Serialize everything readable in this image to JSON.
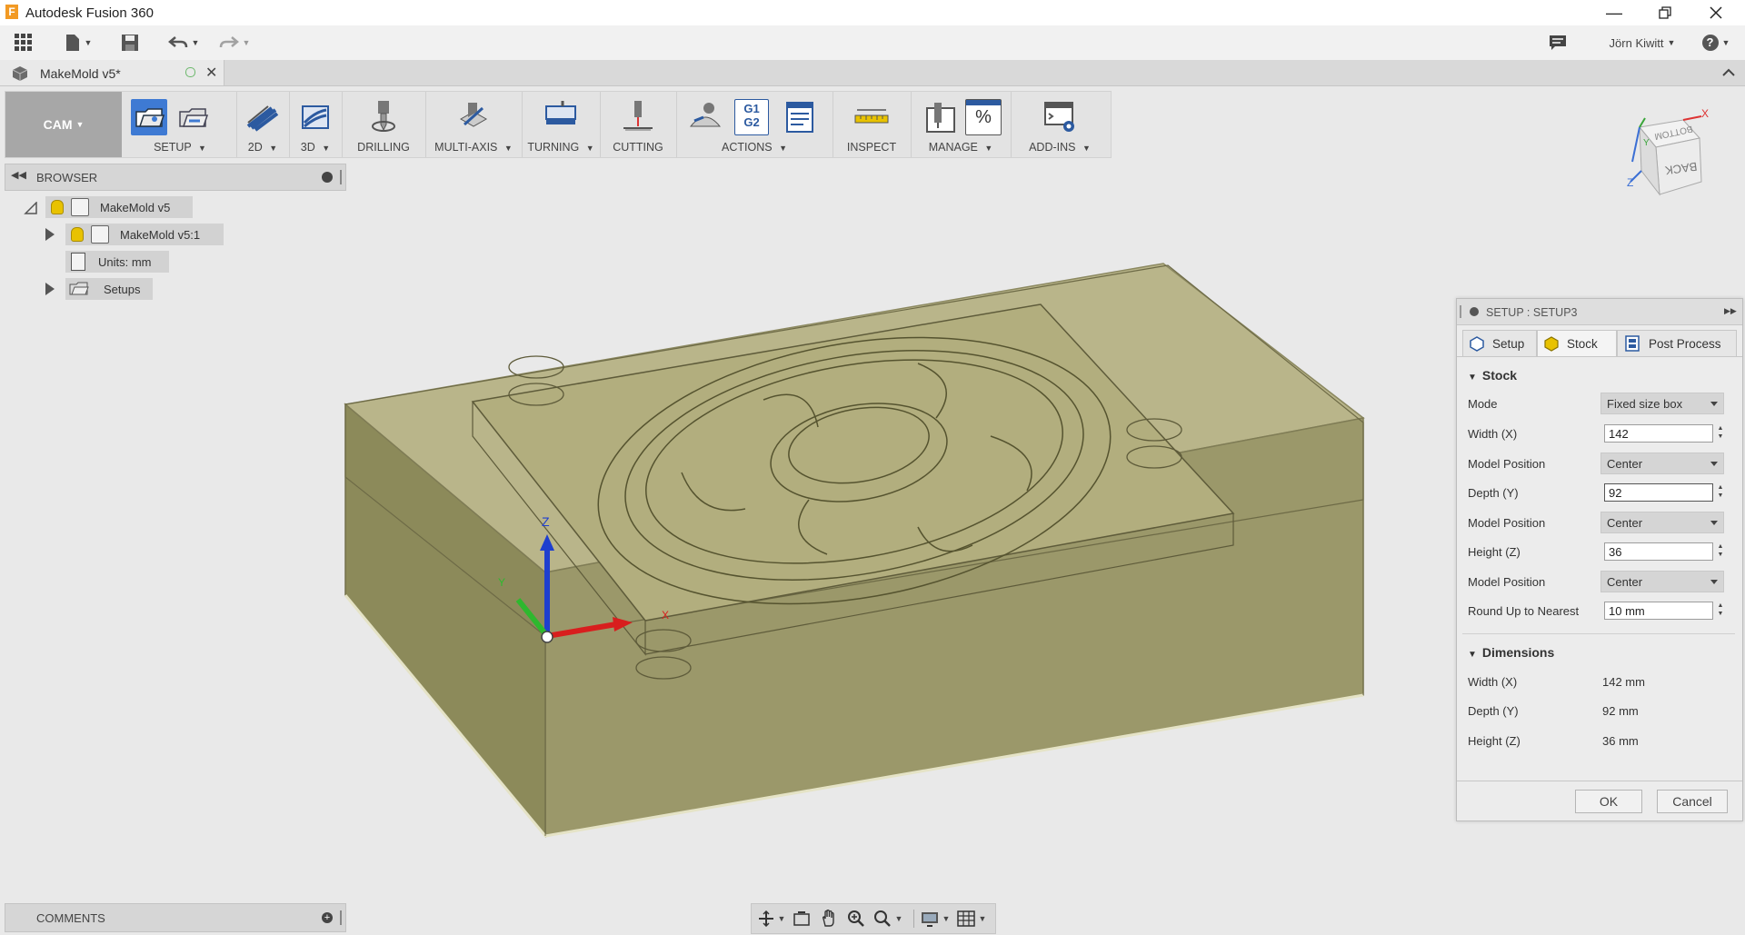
{
  "app": {
    "title": "Autodesk Fusion 360",
    "user": "Jörn Kiwitt",
    "help_label": "?",
    "window_controls": [
      "minimize-icon",
      "restore-icon",
      "close-icon"
    ]
  },
  "document_tab": {
    "name": "MakeMold v5*"
  },
  "ribbon": {
    "workspace": "CAM",
    "groups": [
      {
        "label": "SETUP",
        "has_menu": true
      },
      {
        "label": "2D",
        "has_menu": true
      },
      {
        "label": "3D",
        "has_menu": true
      },
      {
        "label": "DRILLING",
        "has_menu": false
      },
      {
        "label": "MULTI-AXIS",
        "has_menu": true
      },
      {
        "label": "TURNING",
        "has_menu": true
      },
      {
        "label": "CUTTING",
        "has_menu": false
      },
      {
        "label": "ACTIONS",
        "has_menu": true
      },
      {
        "label": "INSPECT",
        "has_menu": false
      },
      {
        "label": "MANAGE",
        "has_menu": true
      },
      {
        "label": "ADD-INS",
        "has_menu": true
      }
    ],
    "actions_icon_text": [
      "G1",
      "G2"
    ],
    "manage_icon_text": "%"
  },
  "browser": {
    "title": "BROWSER",
    "items": [
      {
        "label": "MakeMold v5"
      },
      {
        "label": "MakeMold v5:1"
      },
      {
        "label": "Units: mm"
      },
      {
        "label": "Setups"
      }
    ]
  },
  "viewcube": {
    "faces": [
      "BOTTOM",
      "BACK"
    ],
    "axes": [
      "X",
      "Y",
      "Z"
    ]
  },
  "triad": {
    "x": "X",
    "y": "Y",
    "z": "Z"
  },
  "dialog": {
    "title": "SETUP : SETUP3",
    "tabs": [
      "Setup",
      "Stock",
      "Post Process"
    ],
    "selected_tab": "Stock",
    "stock_section": "Stock",
    "fields": [
      {
        "label": "Mode",
        "type": "combo",
        "value": "Fixed size box"
      },
      {
        "label": "Width (X)",
        "type": "input",
        "value": "142"
      },
      {
        "label": "Model Position",
        "type": "combo",
        "value": "Center"
      },
      {
        "label": "Depth (Y)",
        "type": "input",
        "value": "92"
      },
      {
        "label": "Model Position",
        "type": "combo",
        "value": "Center"
      },
      {
        "label": "Height (Z)",
        "type": "input",
        "value": "36"
      },
      {
        "label": "Model Position",
        "type": "combo",
        "value": "Center"
      },
      {
        "label": "Round Up to Nearest",
        "type": "input",
        "value": "10 mm"
      }
    ],
    "dimensions_section": "Dimensions",
    "dimensions": [
      {
        "label": "Width (X)",
        "value": "142 mm"
      },
      {
        "label": "Depth (Y)",
        "value": "92 mm"
      },
      {
        "label": "Height (Z)",
        "value": "36 mm"
      }
    ],
    "ok": "OK",
    "cancel": "Cancel"
  },
  "comments": {
    "title": "COMMENTS"
  },
  "colors": {
    "accent": "#3e7ad3",
    "stock": "#8c8a5a",
    "stock_top": "#c9c69a"
  }
}
